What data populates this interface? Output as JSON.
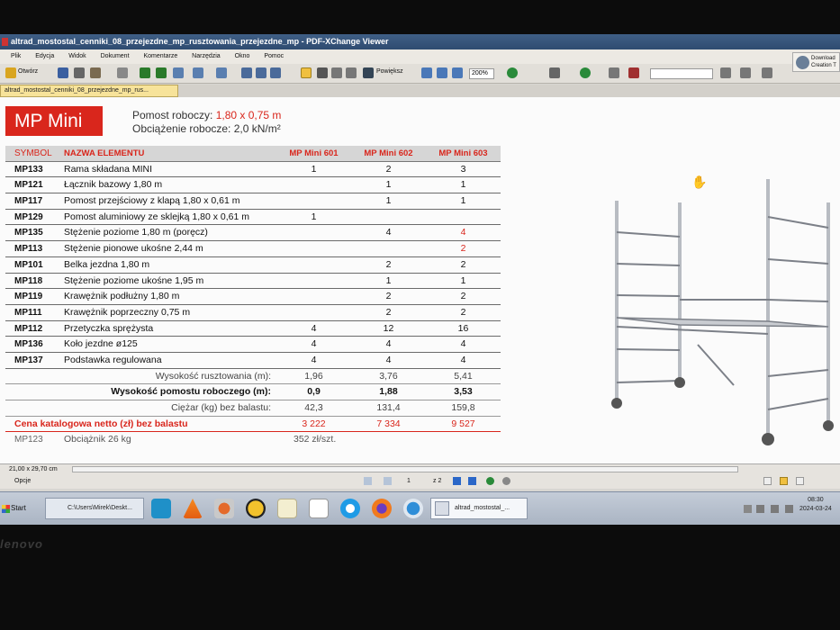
{
  "window": {
    "title": "altrad_mostostal_cenniki_08_przejezdne_mp_rusztowania_przejezdne_mp - PDF-XChange Viewer"
  },
  "menu": [
    "Plik",
    "Edycja",
    "Widok",
    "Dokument",
    "Komentarze",
    "Narzędzia",
    "Okno",
    "Pomoc"
  ],
  "toolbar": {
    "open_label": "Otwórz",
    "zoom_label": "Powiększ",
    "zoom_value": "200%"
  },
  "download": {
    "line1": "Download",
    "line2": "Creation T"
  },
  "doc_tab": "altrad_mostostal_cenniki_08_przejezdne_mp_rus...",
  "doc": {
    "title": "MP Mini",
    "platform_label": "Pomost roboczy: ",
    "platform_value": "1,80 x 0,75 m",
    "load_label": "Obciążenie robocze: 2,0 kN/m²"
  },
  "table": {
    "headers": [
      "SYMBOL",
      "NAZWA ELEMENTU",
      "MP Mini 601",
      "MP Mini 602",
      "MP Mini 603"
    ],
    "rows": [
      {
        "sym": "MP133",
        "name": "Rama składana MINI",
        "v1": "1",
        "v2": "2",
        "v3": "3",
        "v3red": false
      },
      {
        "sym": "MP121",
        "name": "Łącznik bazowy 1,80 m",
        "v1": "",
        "v2": "1",
        "v3": "1",
        "v3red": false
      },
      {
        "sym": "MP117",
        "name": "Pomost przejściowy z klapą 1,80 x 0,61 m",
        "v1": "",
        "v2": "1",
        "v3": "1",
        "v3red": false
      },
      {
        "sym": "MP129",
        "name": "Pomost aluminiowy ze sklejką 1,80 x 0,61 m",
        "v1": "1",
        "v2": "",
        "v3": "",
        "v3red": false
      },
      {
        "sym": "MP135",
        "name": "Stężenie poziome 1,80 m (poręcz)",
        "v1": "",
        "v2": "4",
        "v3": "4",
        "v3red": true
      },
      {
        "sym": "MP113",
        "name": "Stężenie pionowe ukośne 2,44 m",
        "v1": "",
        "v2": "",
        "v3": "2",
        "v3red": true
      },
      {
        "sym": "MP101",
        "name": "Belka jezdna 1,80 m",
        "v1": "",
        "v2": "2",
        "v3": "2",
        "v3red": false
      },
      {
        "sym": "MP118",
        "name": "Stężenie poziome ukośne 1,95 m",
        "v1": "",
        "v2": "1",
        "v3": "1",
        "v3red": false
      },
      {
        "sym": "MP119",
        "name": "Krawężnik podłużny 1,80 m",
        "v1": "",
        "v2": "2",
        "v3": "2",
        "v3red": false
      },
      {
        "sym": "MP111",
        "name": "Krawężnik poprzeczny 0,75 m",
        "v1": "",
        "v2": "2",
        "v3": "2",
        "v3red": false
      },
      {
        "sym": "MP112",
        "name": "Przetyczka sprężysta",
        "v1": "4",
        "v2": "12",
        "v3": "16",
        "v3red": false
      },
      {
        "sym": "MP136",
        "name": "Koło jezdne ø125",
        "v1": "4",
        "v2": "4",
        "v3": "4",
        "v3red": false
      },
      {
        "sym": "MP137",
        "name": "Podstawka regulowana",
        "v1": "4",
        "v2": "4",
        "v3": "4",
        "v3red": false
      }
    ],
    "summary": [
      {
        "label": "Wysokość rusztowania (m):",
        "v1": "1,96",
        "v2": "3,76",
        "v3": "5,41"
      },
      {
        "label": "Wysokość pomostu roboczego (m):",
        "v1": "0,9",
        "v2": "1,88",
        "v3": "3,53"
      },
      {
        "label": "Ciężar (kg) bez balastu:",
        "v1": "42,3",
        "v2": "131,4",
        "v3": "159,8"
      }
    ],
    "price": {
      "label": "Cena katalogowa netto (zł) bez balastu",
      "v1": "3 222",
      "v2": "7 334",
      "v3": "9 527"
    },
    "extra": {
      "sym": "MP123",
      "name": "Obciążnik 26 kg",
      "value": "352 zł/szt."
    }
  },
  "status": {
    "page_size": "21,00 x 29,70 cm",
    "options": "Opcje",
    "page_num": "1",
    "page_count": "z 2"
  },
  "taskbar": {
    "start": "Start",
    "explorer": "C:\\Users\\Mirek\\Deskt...",
    "pdf": "altrad_mostostal_...",
    "time": "08:30",
    "date": "2024-03-24"
  },
  "bezel": "lenovo"
}
